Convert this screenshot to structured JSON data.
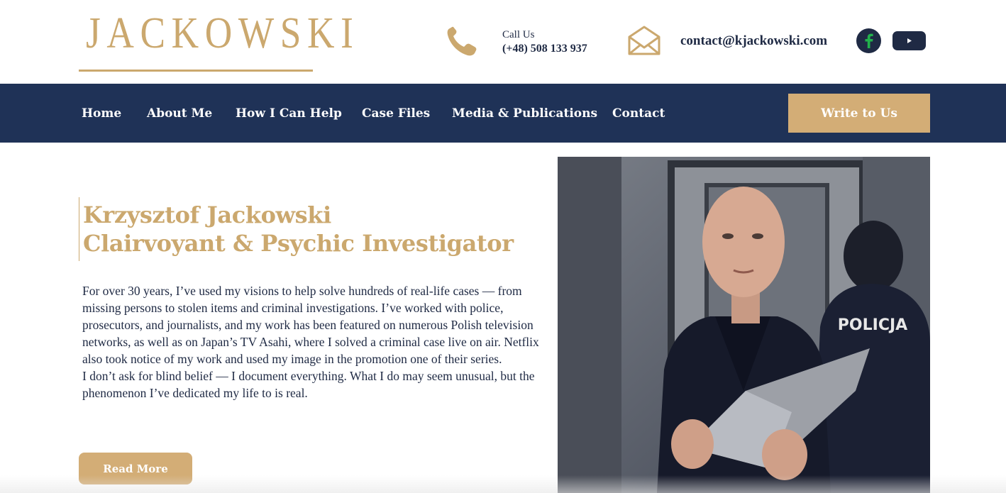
{
  "header": {
    "logo_text": "JACKOWSKI",
    "call_label": "Call Us",
    "phone": "(+48) 508 133 937",
    "email": "contact@kjackowski.com",
    "icons": [
      "phone-icon",
      "envelope-icon",
      "facebook-icon",
      "youtube-icon"
    ]
  },
  "nav": {
    "items": [
      "Home",
      "About Me",
      "How I Can Help",
      "Case Files",
      "Media & Publications",
      "Contact"
    ],
    "cta": "Write to Us"
  },
  "hero": {
    "title_line1": "Krzysztof Jackowski",
    "title_line2": "Clairvoyant & Psychic Investigator",
    "paragraph1": "For over 30 years, I’ve used my visions to help solve hundreds of real-life cases — from missing persons to stolen items and criminal investigations. I’ve worked with police, prosecutors, and journalists, and my work has been featured on numerous Polish television networks, as well as on Japan’s TV Asahi, where I solved a criminal case live on air. Netflix also took notice of my work and used my image in the promotion one of their series.",
    "paragraph2": "I don’t ask for blind belief — I document everything. What I do may seem unusual, but the phenomenon I’ve dedicated my life to is real.",
    "button": "Read More",
    "photo_badge": "POLICJA"
  },
  "colors": {
    "gold": "#cba86e",
    "gold_button": "#d3ad76",
    "navy": "#1f3257",
    "text": "#1f2a44",
    "facebook_green": "#22b24c"
  }
}
